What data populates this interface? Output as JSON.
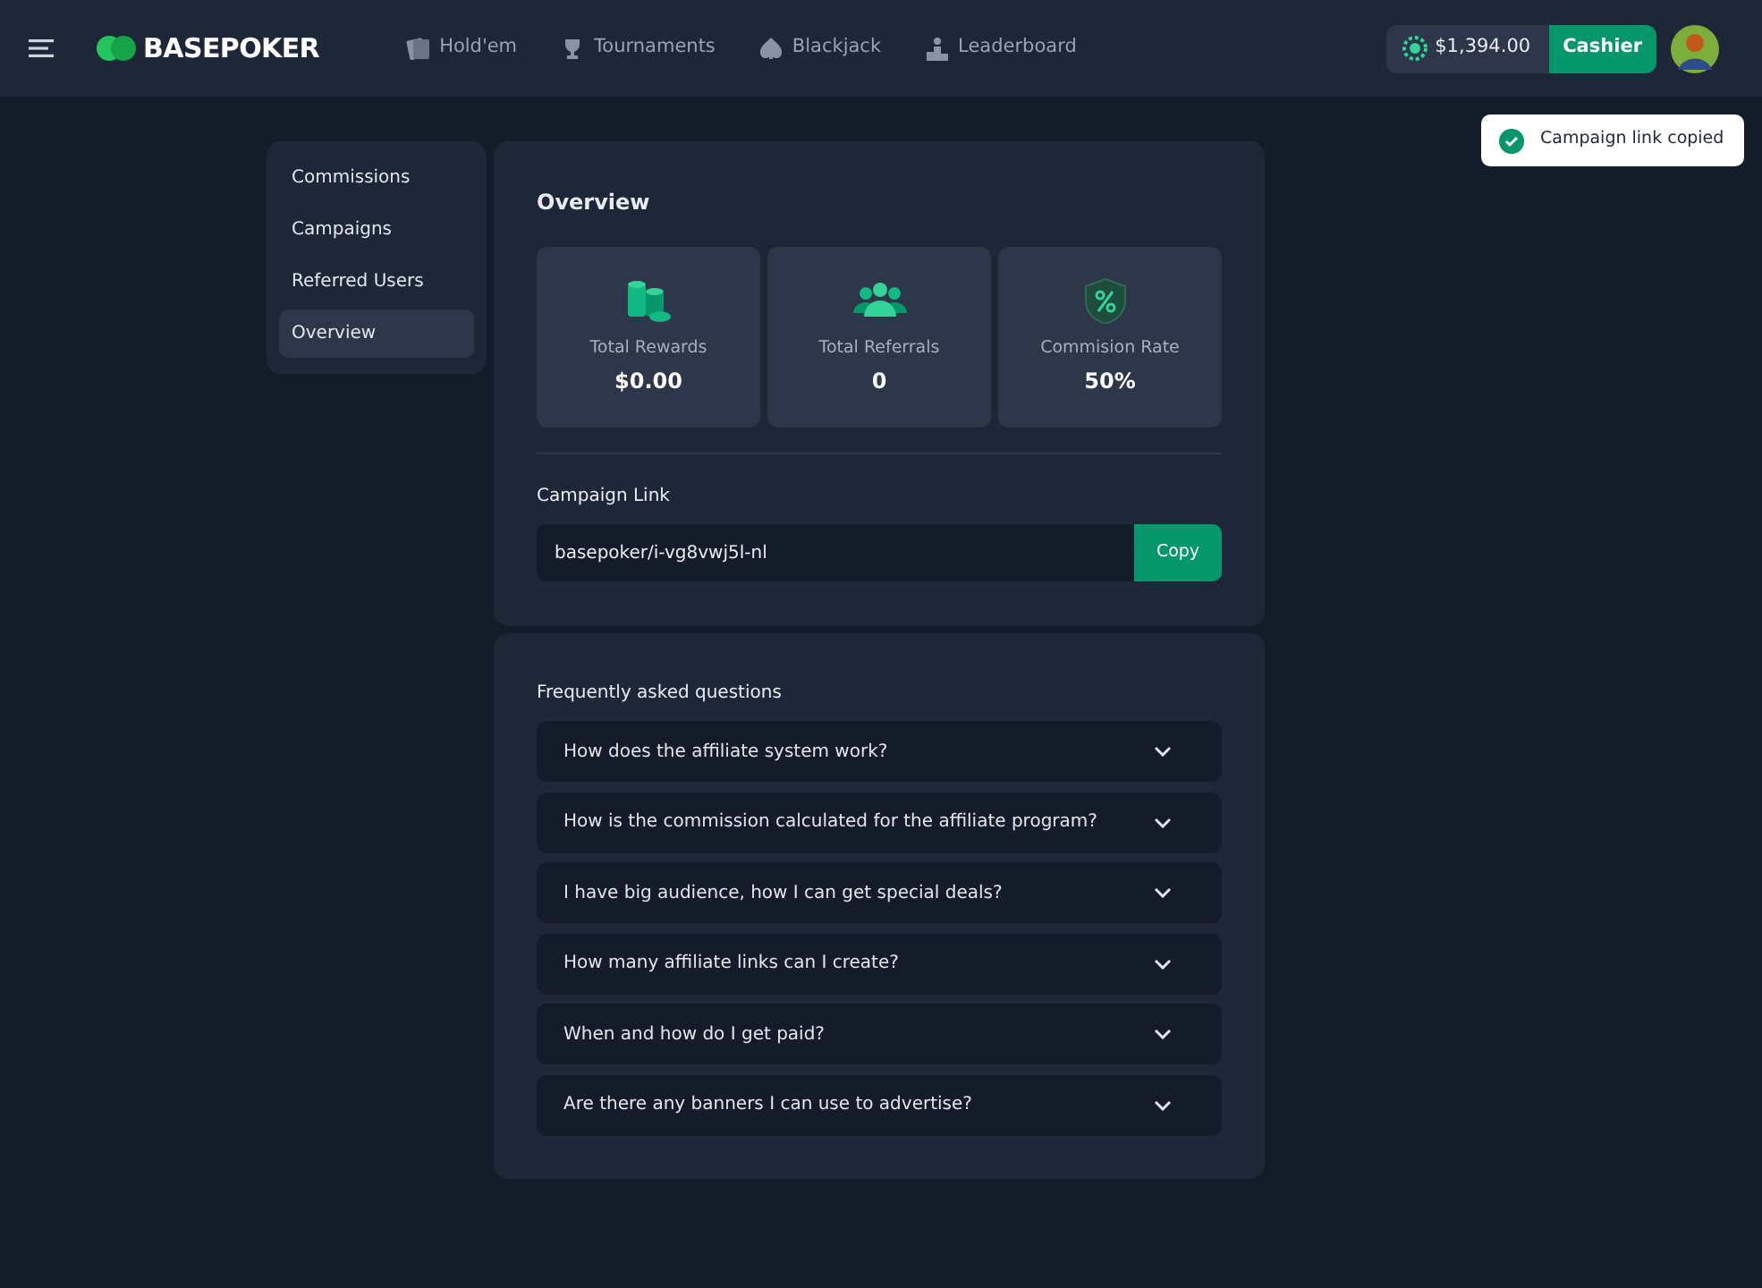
{
  "brand": "BASEPOKER",
  "nav": [
    {
      "label": "Hold'em"
    },
    {
      "label": "Tournaments"
    },
    {
      "label": "Blackjack"
    },
    {
      "label": "Leaderboard"
    }
  ],
  "balance": "$1,394.00",
  "cashier": "Cashier",
  "toast": "Campaign link copied",
  "sidebar": [
    {
      "label": "Commissions",
      "selected": false
    },
    {
      "label": "Campaigns",
      "selected": false
    },
    {
      "label": "Referred Users",
      "selected": false
    },
    {
      "label": "Overview",
      "selected": true
    }
  ],
  "overview": {
    "title": "Overview",
    "stats": [
      {
        "label": "Total Rewards",
        "value": "$0.00"
      },
      {
        "label": "Total Referrals",
        "value": "0"
      },
      {
        "label": "Commision Rate",
        "value": "50%"
      }
    ],
    "link_label": "Campaign Link",
    "link": "basepoker/i-vg8vwj5l-nl",
    "copy": "Copy"
  },
  "faq": {
    "title": "Frequently asked questions",
    "items": [
      {
        "question": "How does the affiliate system work?",
        "expanded": false
      },
      {
        "question": "How is the commission calculated for the affiliate program?",
        "expanded": false
      },
      {
        "question": "I have big audience, how I can get special deals?",
        "expanded": false
      },
      {
        "question": "How many affiliate links can I create?",
        "expanded": false
      },
      {
        "question": "When and how do I get paid?",
        "expanded": false
      },
      {
        "question": "Are there any banners I can use to advertise?",
        "expanded": false
      }
    ]
  }
}
